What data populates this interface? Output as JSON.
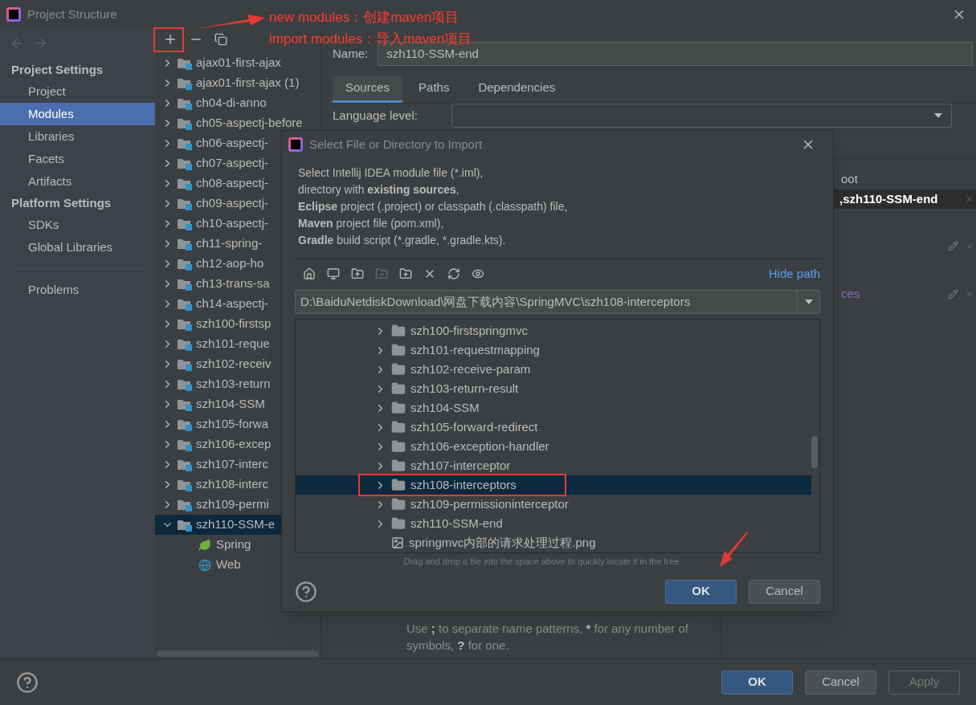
{
  "window": {
    "title": "Project Structure"
  },
  "annotations": [
    {
      "text": "new modules：创建maven项目"
    },
    {
      "text": "import modules：导入maven项目"
    }
  ],
  "sidebar": {
    "sections": [
      {
        "title": "Project Settings",
        "items": [
          {
            "label": "Project",
            "selected": false
          },
          {
            "label": "Modules",
            "selected": true
          },
          {
            "label": "Libraries",
            "selected": false
          },
          {
            "label": "Facets",
            "selected": false
          },
          {
            "label": "Artifacts",
            "selected": false
          }
        ]
      },
      {
        "title": "Platform Settings",
        "items": [
          {
            "label": "SDKs",
            "selected": false
          },
          {
            "label": "Global Libraries",
            "selected": false
          }
        ]
      }
    ],
    "extra_items": [
      {
        "label": "Problems",
        "selected": false
      }
    ]
  },
  "module_tree": {
    "items": [
      {
        "label": "ajax01-first-ajax",
        "expanded": false,
        "selected": false
      },
      {
        "label": "ajax01-first-ajax (1)",
        "expanded": false,
        "selected": false
      },
      {
        "label": "ch04-di-anno",
        "expanded": false,
        "selected": false
      },
      {
        "label": "ch05-aspectj-before",
        "expanded": false,
        "selected": false
      },
      {
        "label": "ch06-aspectj-",
        "expanded": false,
        "selected": false
      },
      {
        "label": "ch07-aspectj-",
        "expanded": false,
        "selected": false
      },
      {
        "label": "ch08-aspectj-",
        "expanded": false,
        "selected": false
      },
      {
        "label": "ch09-aspectj-",
        "expanded": false,
        "selected": false
      },
      {
        "label": "ch10-aspectj-",
        "expanded": false,
        "selected": false
      },
      {
        "label": "ch11-spring-",
        "expanded": false,
        "selected": false
      },
      {
        "label": "ch12-aop-ho",
        "expanded": false,
        "selected": false
      },
      {
        "label": "ch13-trans-sa",
        "expanded": false,
        "selected": false
      },
      {
        "label": "ch14-aspectj-",
        "expanded": false,
        "selected": false
      },
      {
        "label": "szh100-firstsp",
        "expanded": false,
        "selected": false
      },
      {
        "label": "szh101-reque",
        "expanded": false,
        "selected": false
      },
      {
        "label": "szh102-receiv",
        "expanded": false,
        "selected": false
      },
      {
        "label": "szh103-return",
        "expanded": false,
        "selected": false
      },
      {
        "label": "szh104-SSM",
        "expanded": false,
        "selected": false
      },
      {
        "label": "szh105-forwa",
        "expanded": false,
        "selected": false
      },
      {
        "label": "szh106-excep",
        "expanded": false,
        "selected": false
      },
      {
        "label": "szh107-interc",
        "expanded": false,
        "selected": false
      },
      {
        "label": "szh108-interc",
        "expanded": false,
        "selected": false
      },
      {
        "label": "szh109-permi",
        "expanded": false,
        "selected": false
      },
      {
        "label": "szh110-SSM-e",
        "expanded": true,
        "selected": true,
        "children": [
          {
            "label": "Spring",
            "kind": "spring"
          },
          {
            "label": "Web",
            "kind": "web"
          }
        ]
      }
    ]
  },
  "module_editor": {
    "name_label": "Name:",
    "name_value": "szh110-SSM-end",
    "tabs": [
      {
        "label": "Sources",
        "selected": true
      },
      {
        "label": "Paths",
        "selected": false
      },
      {
        "label": "Dependencies",
        "selected": false
      }
    ],
    "language_label": "Language level:",
    "root_label_fragment": "oot",
    "root_path_fragment": ",szh110-SSM-end",
    "folder_label_fragment": "ces",
    "pattern_hint": [
      {
        "text": "Use ",
        "bold": false
      },
      {
        "text": ";",
        "bold": true
      },
      {
        "text": " to separate name patterns, ",
        "bold": false
      },
      {
        "text": "*",
        "bold": true
      },
      {
        "text": " for any number of symbols, ",
        "bold": false
      },
      {
        "text": "?",
        "bold": true
      },
      {
        "text": " for one.",
        "bold": false
      }
    ]
  },
  "import_dialog": {
    "title": "Select File or Directory to Import",
    "description": [
      [
        {
          "text": "Select Intellij IDEA module file (*.iml),",
          "bold": false
        }
      ],
      [
        {
          "text": "directory with ",
          "bold": false
        },
        {
          "text": "existing sources",
          "bold": true
        },
        {
          "text": ",",
          "bold": false
        }
      ],
      [
        {
          "text": "Eclipse",
          "bold": true
        },
        {
          "text": " project (.project) or classpath (.classpath) file,",
          "bold": false
        }
      ],
      [
        {
          "text": "Maven",
          "bold": true
        },
        {
          "text": " project file (pom.xml),",
          "bold": false
        }
      ],
      [
        {
          "text": "Gradle",
          "bold": true
        },
        {
          "text": " build script (*.gradle, *.gradle.kts).",
          "bold": false
        }
      ]
    ],
    "hide_path_link": "Hide path",
    "path": "D:\\BaiduNetdiskDownload\\网盘下载内容\\SpringMVC\\szh108-interceptors",
    "tree": [
      {
        "label": "szh100-firstspringmvc",
        "kind": "folder",
        "selected": false
      },
      {
        "label": "szh101-requestmapping",
        "kind": "folder",
        "selected": false
      },
      {
        "label": "szh102-receive-param",
        "kind": "folder",
        "selected": false
      },
      {
        "label": "szh103-return-result",
        "kind": "folder",
        "selected": false
      },
      {
        "label": "szh104-SSM",
        "kind": "folder",
        "selected": false
      },
      {
        "label": "szh105-forward-redirect",
        "kind": "folder",
        "selected": false
      },
      {
        "label": "szh106-exception-handler",
        "kind": "folder",
        "selected": false
      },
      {
        "label": "szh107-interceptor",
        "kind": "folder",
        "selected": false
      },
      {
        "label": "szh108-interceptors",
        "kind": "folder",
        "selected": true
      },
      {
        "label": "szh109-permissioninterceptor",
        "kind": "folder",
        "selected": false
      },
      {
        "label": "szh110-SSM-end",
        "kind": "folder",
        "selected": false
      },
      {
        "label": "springmvc内部的请求处理过程.png",
        "kind": "file",
        "selected": false
      }
    ],
    "hint": "Drag and drop a file into the space above to quickly locate it in the tree",
    "buttons": [
      {
        "label": "OK",
        "default": true
      },
      {
        "label": "Cancel",
        "default": false
      }
    ]
  },
  "buttons": [
    {
      "label": "OK",
      "default": true,
      "disabled": false
    },
    {
      "label": "Cancel",
      "default": false,
      "disabled": false
    },
    {
      "label": "Apply",
      "default": false,
      "disabled": true
    }
  ]
}
